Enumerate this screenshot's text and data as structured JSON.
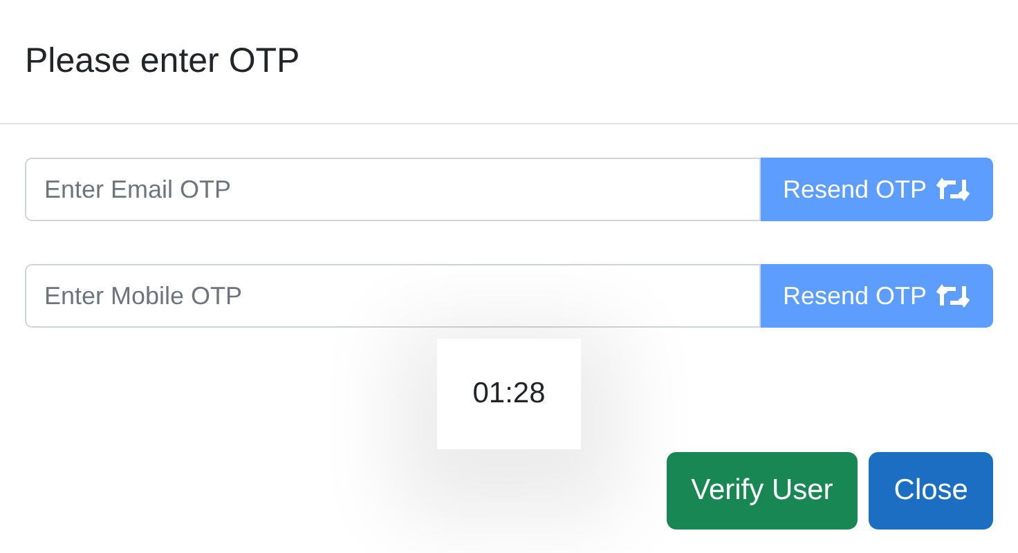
{
  "modal": {
    "title": "Please enter OTP"
  },
  "otp_fields": [
    {
      "placeholder": "Enter Email OTP",
      "button": "Resend OTP",
      "disabled": true
    },
    {
      "placeholder": "Enter Mobile OTP",
      "button": "Resend OTP",
      "disabled": true
    }
  ],
  "timer": "01:28",
  "buttons": [
    {
      "label": "Verify User",
      "kind": "success"
    },
    {
      "label": "Close",
      "kind": "primary"
    }
  ]
}
